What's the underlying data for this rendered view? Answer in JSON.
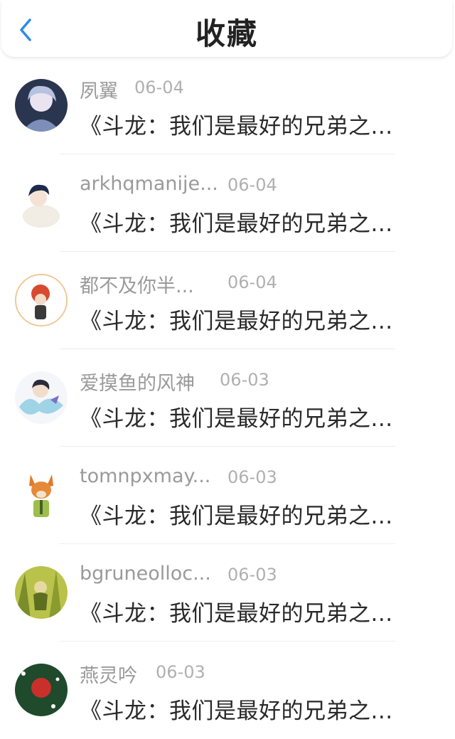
{
  "header": {
    "title": "收藏",
    "back_icon": "chevron-left-icon",
    "accent_color": "#2f8be6"
  },
  "items": [
    {
      "name": "夙翼",
      "date": "06-04",
      "text": "《斗龙：我们是最好的兄弟之..."
    },
    {
      "name": "arkhqmanije...",
      "date": "06-04",
      "text": "《斗龙：我们是最好的兄弟之..."
    },
    {
      "name": "都不及你半...",
      "date": "06-04",
      "text": "《斗龙：我们是最好的兄弟之..."
    },
    {
      "name": "爱摸鱼的风神",
      "date": "06-03",
      "text": "《斗龙：我们是最好的兄弟之..."
    },
    {
      "name": "tomnpxmay...",
      "date": "06-03",
      "text": "《斗龙：我们是最好的兄弟之..."
    },
    {
      "name": "bgruneolloc...",
      "date": "06-03",
      "text": "《斗龙：我们是最好的兄弟之..."
    },
    {
      "name": "燕灵吟",
      "date": "06-03",
      "text": "《斗龙：我们是最好的兄弟之..."
    }
  ]
}
